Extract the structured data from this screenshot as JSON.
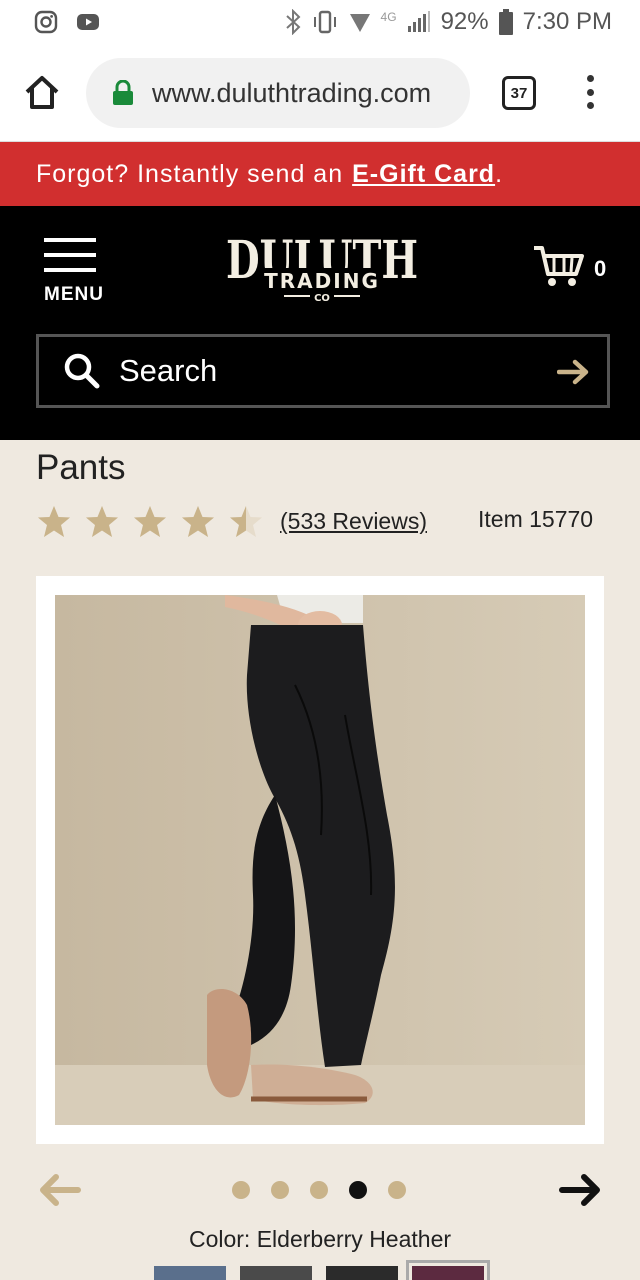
{
  "status_bar": {
    "network": "4G",
    "battery": "92%",
    "time": "7:30 PM"
  },
  "browser": {
    "url": "www.duluthtrading.com",
    "tab_count": "37"
  },
  "promo": {
    "text": "Forgot? Instantly send an",
    "link": "E-Gift Card",
    "trailing": "."
  },
  "header": {
    "menu_label": "MENU",
    "logo_text": "DULUTH TRADING CO",
    "cart_count": "0",
    "search_placeholder": "Search"
  },
  "product": {
    "title": "Pants",
    "rating": 4.5,
    "rating_max": 5,
    "reviews": "(533 Reviews)",
    "item_number": "Item 15770",
    "carousel_index": 4,
    "carousel_total": 5,
    "color_label": "Color: Elderberry Heather",
    "swatch_colors": [
      "#5a6f8c",
      "#4a4a4a",
      "#2b2b2b",
      "#5c2a40"
    ]
  },
  "colors": {
    "promo_red": "#d12f2f",
    "header_black": "#000000",
    "page_bg": "#efe9e0",
    "star_gold": "#c9b38a"
  }
}
